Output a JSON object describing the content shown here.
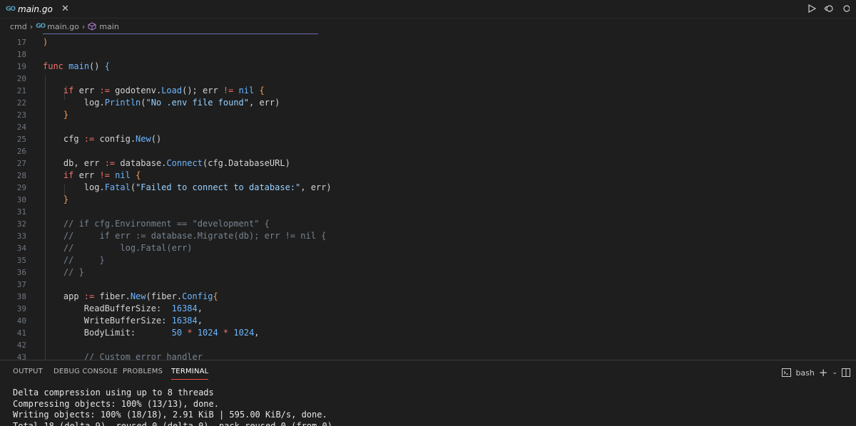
{
  "tab": {
    "title": "main.go",
    "icon": "go-file-icon"
  },
  "breadcrumb": {
    "folder": "cmd",
    "file": "main.go",
    "symbol": "main"
  },
  "editor": {
    "lines": [
      {
        "n": "17",
        "html": "<span class=\"pn\">)</span>"
      },
      {
        "n": "18",
        "html": ""
      },
      {
        "n": "19",
        "html": "<span class=\"kw\">func</span> <span class=\"fn\">main</span>() <span class=\"fn\">{</span>"
      },
      {
        "n": "20",
        "html": ""
      },
      {
        "n": "21",
        "html": "    <span class=\"kw\">if</span> err <span class=\"op\">:=</span> godotenv.<span class=\"fn\">Load</span>(); err <span class=\"op\">!=</span> <span class=\"fn\">nil</span> <span class=\"pn\">{</span>"
      },
      {
        "n": "22",
        "html": "        log.<span class=\"fn\">Println</span>(<span class=\"str\">\"No .env file found\"</span>, err)"
      },
      {
        "n": "23",
        "html": "    <span class=\"pn\">}</span>"
      },
      {
        "n": "24",
        "html": ""
      },
      {
        "n": "25",
        "html": "    cfg <span class=\"op\">:=</span> config.<span class=\"fn\">New</span>()"
      },
      {
        "n": "26",
        "html": ""
      },
      {
        "n": "27",
        "html": "    db, err <span class=\"op\">:=</span> database.<span class=\"fn\">Connect</span>(cfg.DatabaseURL)"
      },
      {
        "n": "28",
        "html": "    <span class=\"kw\">if</span> err <span class=\"op\">!=</span> <span class=\"fn\">nil</span> <span class=\"pn\">{</span>"
      },
      {
        "n": "29",
        "html": "        log.<span class=\"fn\">Fatal</span>(<span class=\"str\">\"Failed to connect to database:\"</span>, err)"
      },
      {
        "n": "30",
        "html": "    <span class=\"pn\">}</span>"
      },
      {
        "n": "31",
        "html": ""
      },
      {
        "n": "32",
        "html": "    <span class=\"cmt\">// if cfg.Environment == \"development\" {</span>"
      },
      {
        "n": "33",
        "html": "    <span class=\"cmt\">//     if err := database.Migrate(db); err != nil {</span>"
      },
      {
        "n": "34",
        "html": "    <span class=\"cmt\">//         log.Fatal(err)</span>"
      },
      {
        "n": "35",
        "html": "    <span class=\"cmt\">//     }</span>"
      },
      {
        "n": "36",
        "html": "    <span class=\"cmt\">// }</span>"
      },
      {
        "n": "37",
        "html": ""
      },
      {
        "n": "38",
        "html": "    app <span class=\"op\">:=</span> fiber.<span class=\"fn\">New</span>(fiber.<span class=\"fn\">Config</span><span class=\"pn\">{</span>"
      },
      {
        "n": "39",
        "html": "        ReadBufferSize:  <span class=\"num\">16384</span>,"
      },
      {
        "n": "40",
        "html": "        WriteBufferSize: <span class=\"num\">16384</span>,"
      },
      {
        "n": "41",
        "html": "        BodyLimit:       <span class=\"num\">50</span> <span class=\"op\">*</span> <span class=\"num\">1024</span> <span class=\"op\">*</span> <span class=\"num\">1024</span>,"
      },
      {
        "n": "42",
        "html": ""
      },
      {
        "n": "43",
        "html": "        <span class=\"cmt\">// Custom error handler</span>"
      }
    ]
  },
  "panel": {
    "tabs": [
      "OUTPUT",
      "DEBUG CONSOLE",
      "PROBLEMS",
      "TERMINAL"
    ],
    "active_tab": "TERMINAL",
    "shell": "bash",
    "terminal_lines": [
      "Delta compression using up to 8 threads",
      "Compressing objects: 100% (13/13), done.",
      "Writing objects: 100% (18/18), 2.91 KiB | 595.00 KiB/s, done.",
      "Total 18 (delta 9), reused 0 (delta 0), pack-reused 0 (from 0)"
    ]
  }
}
